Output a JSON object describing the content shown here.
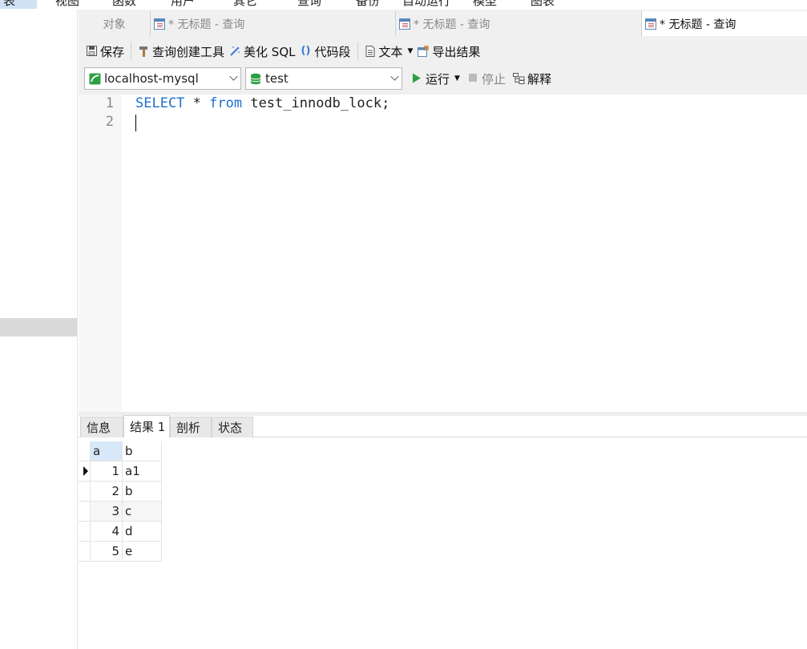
{
  "menu": {
    "items": [
      "表",
      "视图",
      "函数",
      "用户",
      "其它",
      "查询",
      "备份",
      "自动运行",
      "模型",
      "图表"
    ]
  },
  "tabs": {
    "objects": "对象",
    "query_tabs": [
      {
        "label": "* 无标题 - 查询",
        "active": false
      },
      {
        "label": "* 无标题 - 查询",
        "active": false
      },
      {
        "label": "* 无标题 - 查询",
        "active": true
      }
    ]
  },
  "toolbar": {
    "save": "保存",
    "query_builder": "查询创建工具",
    "beautify": "美化 SQL",
    "snippet": "代码段",
    "text": "文本",
    "export": "导出结果"
  },
  "connection": {
    "name": "localhost-mysql",
    "database": "test",
    "run": "运行",
    "stop": "停止",
    "explain": "解释"
  },
  "editor": {
    "lines": [
      {
        "number": "1",
        "keyword1": "SELECT",
        "text1": " * ",
        "keyword2": "from",
        "text2": " test_innodb_lock;"
      },
      {
        "number": "2"
      }
    ]
  },
  "result_tabs": [
    "信息",
    "结果 1",
    "剖析",
    "状态"
  ],
  "result_active_tab": 1,
  "grid": {
    "columns": [
      "a",
      "b"
    ],
    "rows": [
      [
        "1",
        "a1"
      ],
      [
        "2",
        "b"
      ],
      [
        "3",
        "c"
      ],
      [
        "4",
        "d"
      ],
      [
        "5",
        "e"
      ]
    ],
    "current_row": 0
  },
  "colors": {
    "keyword": "#1f6fd1",
    "run": "#2ea043",
    "db": "#2ea043",
    "selection": "#d7e8f8"
  }
}
